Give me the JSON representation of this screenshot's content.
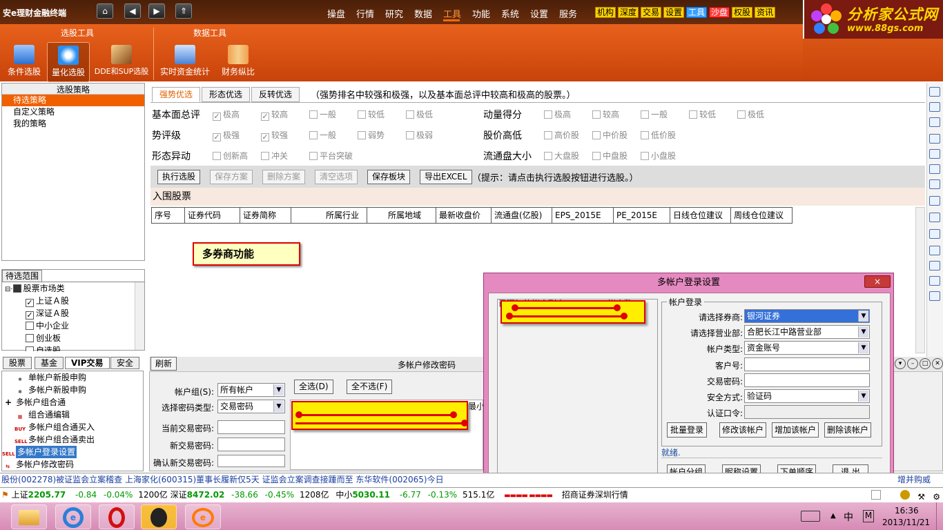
{
  "app": {
    "brand": "安e理财金融终端",
    "nav_buttons": [
      "⌂",
      "◀",
      "▶",
      "⇑"
    ],
    "menu": [
      "操盘",
      "行情",
      "研究",
      "数据",
      "工具",
      "功能",
      "系统",
      "设置",
      "服务"
    ],
    "menu_active": "工具",
    "quick_buttons": [
      "机构",
      "深度",
      "交易",
      "设置",
      "工具",
      "沙盘",
      "权股",
      "资讯"
    ],
    "logo_line1": "分析家公式网",
    "logo_line2": "www.88gs.com"
  },
  "toolbar": {
    "group1": "选股工具",
    "group2": "数据工具",
    "tools": [
      "条件选股",
      "量化选股",
      "DDE和SUP选股",
      "实时资金统计",
      "财务纵比"
    ]
  },
  "strategy_panel": {
    "header": "选股策略",
    "items": [
      "待选策略",
      "自定义策略",
      "我的策略"
    ]
  },
  "range_panel": {
    "title": "待选范围",
    "items": [
      "股票市场类",
      "上证Ａ股",
      "深证Ａ股",
      "中小企业",
      "创业板",
      "自选股"
    ]
  },
  "tabs": [
    "强势优选",
    "形态优选",
    "反转优选"
  ],
  "tabs_hint": "（强势排名中较强和极强，以及基本面总评中较高和极高的股票。）",
  "criteria": {
    "fundamental": {
      "label": "基本面总评",
      "options": [
        "极高",
        "较高",
        "一般",
        "较低",
        "极低"
      ]
    },
    "trend": {
      "label": "势评级",
      "options": [
        "极强",
        "较强",
        "一般",
        "弱势",
        "极弱"
      ]
    },
    "pattern": {
      "label": "形态异动",
      "options": [
        "创新高",
        "冲关",
        "平台突破"
      ]
    },
    "momentum": {
      "label": "动量得分",
      "options": [
        "极高",
        "较高",
        "一般",
        "较低",
        "极低"
      ]
    },
    "price": {
      "label": "股价高低",
      "options": [
        "高价股",
        "中价股",
        "低价股"
      ]
    },
    "float": {
      "label": "流通盘大小",
      "options": [
        "大盘股",
        "中盘股",
        "小盘股"
      ]
    }
  },
  "actions": {
    "buttons": [
      "执行选股",
      "保存方案",
      "删除方案",
      "清空选项",
      "保存板块",
      "导出EXCEL"
    ],
    "hint": "（提示：请点击执行选股按钮进行选股。）"
  },
  "results": {
    "title": "入围股票",
    "columns": [
      "序号",
      "证券代码",
      "证券简称",
      "所属行业",
      "所属地域",
      "最新收盘价",
      "流通盘(亿股)",
      "EPS_2015E",
      "PE_2015E",
      "日线仓位建议",
      "周线仓位建议"
    ]
  },
  "callout": "多券商功能",
  "trade_tabs": [
    "股票",
    "基金",
    "VIP交易",
    "安全"
  ],
  "trade_menu": [
    "单帐户新股申购",
    "多帐户新股申购",
    "多帐户组合通",
    "组合通编辑",
    "多帐户组合通买入",
    "多帐户组合通卖出",
    "多帐户登录设置",
    "多帐户修改密码"
  ],
  "password_panel": {
    "refresh": "刷新",
    "title": "多帐户修改密码",
    "account_group_label": "帐户组(S):",
    "account_group_value": "所有帐户",
    "pwd_type_label": "选择密码类型:",
    "pwd_type_value": "交易密码",
    "current_label": "当前交易密码:",
    "new_label": "新交易密码:",
    "confirm_label": "确认新交易密码:",
    "select_all": "全选(D)",
    "select_none": "全不选(F)",
    "partial_header": "最小"
  },
  "dialog": {
    "title": "多帐户登录设置",
    "close": "×",
    "list_header": "已添加的帐户列表",
    "count_label": "帐户数：",
    "group_title": "帐户登录",
    "broker_label": "请选择券商:",
    "broker_value": "银河证券",
    "branch_label": "请选择营业部:",
    "branch_value": "合肥长江中路营业部",
    "type_label": "帐户类型:",
    "type_value": "资金账号",
    "client_label": "客户号:",
    "trade_pwd_label": "交易密码:",
    "security_label": "安全方式:",
    "security_value": "验证码",
    "auth_label": "认证口令:",
    "buttons": [
      "批量登录",
      "修改该帐户",
      "增加该帐户",
      "删除该帐户"
    ],
    "status": "就绪.",
    "bottom_buttons": [
      "帐户分组",
      "昵称设置",
      "下单顺序",
      "退 出"
    ]
  },
  "ticker": "股份(002278)被证监会立案稽查    上海家化(600315)董事长履新仅5天  证监会立案调查接踵而至    东华软件(002065)今日",
  "ticker_right": "增并购威",
  "status_bar": {
    "sh_label": "上证",
    "sh_value": "2205.77",
    "sh_chg": "-0.84",
    "sh_pct": "-0.04%",
    "sh_amt": "1200亿",
    "sz_label": "深证",
    "sz_value": "8472.02",
    "sz_chg": "-38.66",
    "sz_pct": "-0.45%",
    "sz_amt": "1208亿",
    "zx_label": "中小",
    "zx_value": "5030.11",
    "zx_chg": "-6.77",
    "zx_pct": "-0.13%",
    "zx_amt": "515.1亿",
    "broker_text": "招商证券深圳行情"
  },
  "taskbar": {
    "time": "16:36",
    "date": "2013/11/21",
    "ime": "中",
    "ime2": "M"
  }
}
